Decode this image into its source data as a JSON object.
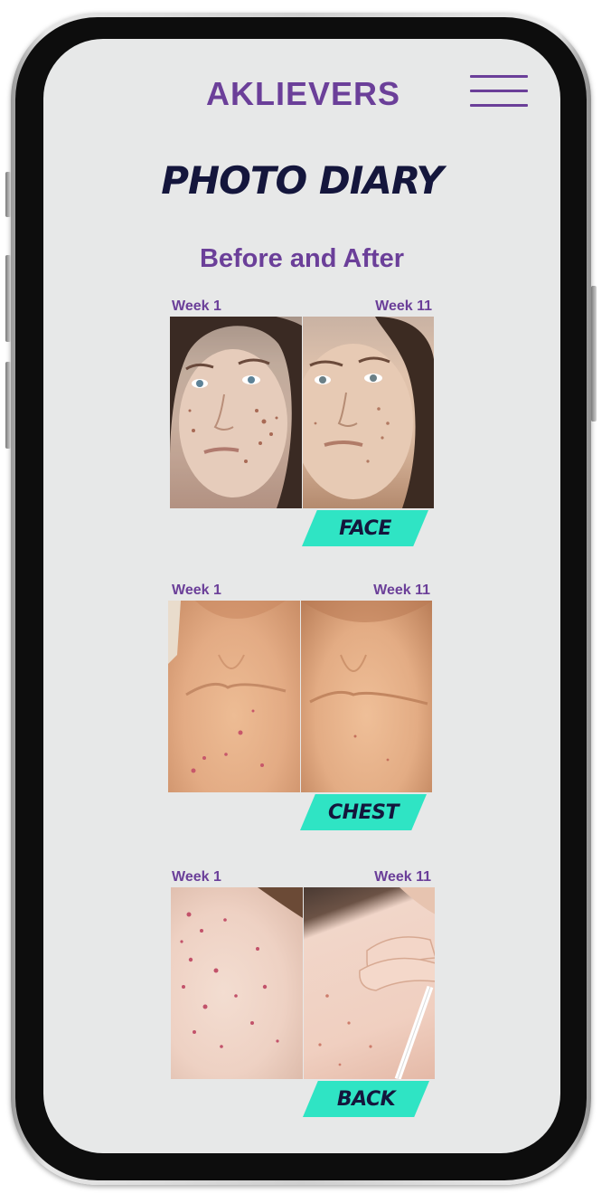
{
  "brand": {
    "logo_text": "AKLIEVERS",
    "accent_color": "#6b3f99",
    "tag_color": "#2fe4c4",
    "title_color": "#14163c"
  },
  "header": {
    "menu_icon": "hamburger-menu-icon"
  },
  "page": {
    "title": "PHOTO DIARY",
    "subtitle": "Before and After"
  },
  "comparisons": [
    {
      "before_label": "Week 1",
      "after_label": "Week 11",
      "area": "FACE"
    },
    {
      "before_label": "Week 1",
      "after_label": "Week 11",
      "area": "CHEST"
    },
    {
      "before_label": "Week 1",
      "after_label": "Week 11",
      "area": "BACK"
    }
  ]
}
